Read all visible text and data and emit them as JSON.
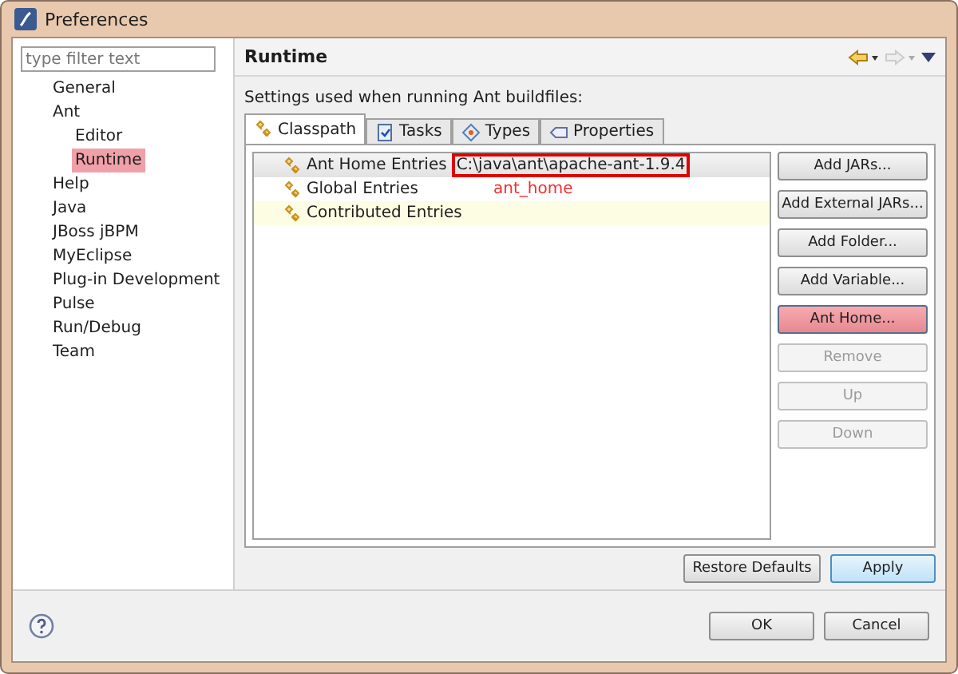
{
  "window": {
    "title": "Preferences"
  },
  "sidebar": {
    "filter": {
      "placeholder": "type filter text"
    },
    "items": [
      {
        "label": "General",
        "selected": false
      },
      {
        "label": "Ant",
        "selected": false,
        "children": [
          {
            "label": "Editor",
            "selected": false
          },
          {
            "label": "Runtime",
            "selected": true
          }
        ]
      },
      {
        "label": "Help",
        "selected": false
      },
      {
        "label": "Java",
        "selected": false
      },
      {
        "label": "JBoss jBPM",
        "selected": false
      },
      {
        "label": "MyEclipse",
        "selected": false
      },
      {
        "label": "Plug-in Development",
        "selected": false
      },
      {
        "label": "Pulse",
        "selected": false
      },
      {
        "label": "Run/Debug",
        "selected": false
      },
      {
        "label": "Team",
        "selected": false
      }
    ]
  },
  "page": {
    "title": "Runtime",
    "description": "Settings used when running Ant buildfiles:",
    "tabs": [
      {
        "label": "Classpath",
        "selected": true
      },
      {
        "label": "Tasks",
        "selected": false
      },
      {
        "label": "Types",
        "selected": false
      },
      {
        "label": "Properties",
        "selected": false
      }
    ],
    "entries": [
      {
        "label": "Ant Home Entries",
        "value": "C:\\java\\ant\\apache-ant-1.9.4",
        "selected": true,
        "highlighted": false
      },
      {
        "label": "Global Entries",
        "selected": false,
        "highlighted": false
      },
      {
        "label": "Contributed Entries",
        "selected": false,
        "highlighted": true
      }
    ],
    "annotation": "ant_home",
    "side_buttons": [
      {
        "label": "Add JARs...",
        "disabled": false,
        "highlighted": false
      },
      {
        "label": "Add External JARs...",
        "disabled": false,
        "highlighted": false
      },
      {
        "label": "Add Folder...",
        "disabled": false,
        "highlighted": false
      },
      {
        "label": "Add Variable...",
        "disabled": false,
        "highlighted": false
      },
      {
        "label": "Ant Home...",
        "disabled": false,
        "highlighted": true
      },
      {
        "label": "Remove",
        "disabled": true,
        "highlighted": false
      },
      {
        "label": "Up",
        "disabled": true,
        "highlighted": false
      },
      {
        "label": "Down",
        "disabled": true,
        "highlighted": false
      }
    ],
    "page_buttons": [
      {
        "label": "Restore Defaults",
        "default": false
      },
      {
        "label": "Apply",
        "default": true
      }
    ]
  },
  "footer": {
    "buttons": [
      {
        "label": "OK"
      },
      {
        "label": "Cancel"
      }
    ]
  }
}
